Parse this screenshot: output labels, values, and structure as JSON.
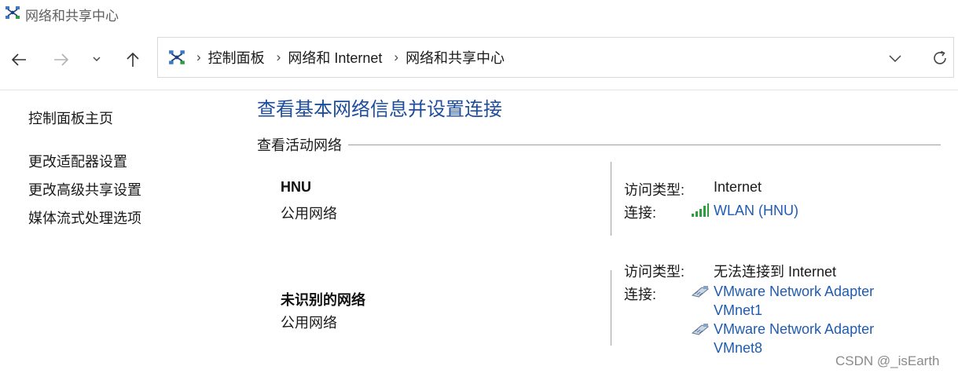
{
  "window": {
    "title": "网络和共享中心",
    "icon": "network-center-icon"
  },
  "nav": {
    "back_icon": "arrow-left-icon",
    "forward_icon": "arrow-right-icon",
    "recent_icon": "chevron-down-icon",
    "up_icon": "arrow-up-icon"
  },
  "address_bar": {
    "icon": "network-center-icon",
    "crumbs": [
      "控制面板",
      "网络和 Internet",
      "网络和共享中心"
    ],
    "dropdown_icon": "chevron-down-icon",
    "refresh_icon": "refresh-icon"
  },
  "sidebar": {
    "home": "控制面板主页",
    "links": [
      "更改适配器设置",
      "更改高级共享设置",
      "媒体流式处理选项"
    ]
  },
  "main": {
    "title": "查看基本网络信息并设置连接",
    "section": "查看活动网络",
    "networks": [
      {
        "name": "HNU",
        "type": "公用网络",
        "access_label": "访问类型:",
        "access_value": "Internet",
        "connection_label": "连接:",
        "connections": [
          {
            "icon": "wifi-signal-icon",
            "line1": "WLAN (HNU)"
          }
        ]
      },
      {
        "name": "未识别的网络",
        "type": "公用网络",
        "access_label": "访问类型:",
        "access_value": "无法连接到 Internet",
        "connection_label": "连接:",
        "connections": [
          {
            "icon": "ethernet-adapter-icon",
            "line1": "VMware Network Adapter",
            "line2": "VMnet1"
          },
          {
            "icon": "ethernet-adapter-icon",
            "line1": "VMware Network Adapter",
            "line2": "VMnet8"
          }
        ]
      }
    ]
  },
  "watermark": "CSDN @_isEarth",
  "colors": {
    "link": "#1f5bb3",
    "title": "#1d4d9c",
    "signal": "#2e9e3e"
  }
}
